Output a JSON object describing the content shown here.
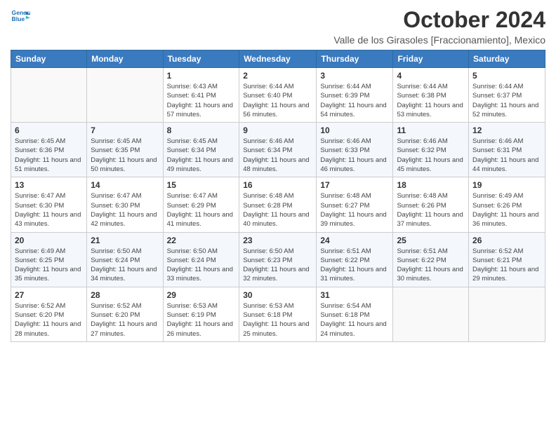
{
  "header": {
    "logo_line1": "General",
    "logo_line2": "Blue",
    "month_title": "October 2024",
    "subtitle": "Valle de los Girasoles [Fraccionamiento], Mexico"
  },
  "days_of_week": [
    "Sunday",
    "Monday",
    "Tuesday",
    "Wednesday",
    "Thursday",
    "Friday",
    "Saturday"
  ],
  "weeks": [
    [
      {
        "day": "",
        "info": ""
      },
      {
        "day": "",
        "info": ""
      },
      {
        "day": "1",
        "info": "Sunrise: 6:43 AM\nSunset: 6:41 PM\nDaylight: 11 hours and 57 minutes."
      },
      {
        "day": "2",
        "info": "Sunrise: 6:44 AM\nSunset: 6:40 PM\nDaylight: 11 hours and 56 minutes."
      },
      {
        "day": "3",
        "info": "Sunrise: 6:44 AM\nSunset: 6:39 PM\nDaylight: 11 hours and 54 minutes."
      },
      {
        "day": "4",
        "info": "Sunrise: 6:44 AM\nSunset: 6:38 PM\nDaylight: 11 hours and 53 minutes."
      },
      {
        "day": "5",
        "info": "Sunrise: 6:44 AM\nSunset: 6:37 PM\nDaylight: 11 hours and 52 minutes."
      }
    ],
    [
      {
        "day": "6",
        "info": "Sunrise: 6:45 AM\nSunset: 6:36 PM\nDaylight: 11 hours and 51 minutes."
      },
      {
        "day": "7",
        "info": "Sunrise: 6:45 AM\nSunset: 6:35 PM\nDaylight: 11 hours and 50 minutes."
      },
      {
        "day": "8",
        "info": "Sunrise: 6:45 AM\nSunset: 6:34 PM\nDaylight: 11 hours and 49 minutes."
      },
      {
        "day": "9",
        "info": "Sunrise: 6:46 AM\nSunset: 6:34 PM\nDaylight: 11 hours and 48 minutes."
      },
      {
        "day": "10",
        "info": "Sunrise: 6:46 AM\nSunset: 6:33 PM\nDaylight: 11 hours and 46 minutes."
      },
      {
        "day": "11",
        "info": "Sunrise: 6:46 AM\nSunset: 6:32 PM\nDaylight: 11 hours and 45 minutes."
      },
      {
        "day": "12",
        "info": "Sunrise: 6:46 AM\nSunset: 6:31 PM\nDaylight: 11 hours and 44 minutes."
      }
    ],
    [
      {
        "day": "13",
        "info": "Sunrise: 6:47 AM\nSunset: 6:30 PM\nDaylight: 11 hours and 43 minutes."
      },
      {
        "day": "14",
        "info": "Sunrise: 6:47 AM\nSunset: 6:30 PM\nDaylight: 11 hours and 42 minutes."
      },
      {
        "day": "15",
        "info": "Sunrise: 6:47 AM\nSunset: 6:29 PM\nDaylight: 11 hours and 41 minutes."
      },
      {
        "day": "16",
        "info": "Sunrise: 6:48 AM\nSunset: 6:28 PM\nDaylight: 11 hours and 40 minutes."
      },
      {
        "day": "17",
        "info": "Sunrise: 6:48 AM\nSunset: 6:27 PM\nDaylight: 11 hours and 39 minutes."
      },
      {
        "day": "18",
        "info": "Sunrise: 6:48 AM\nSunset: 6:26 PM\nDaylight: 11 hours and 37 minutes."
      },
      {
        "day": "19",
        "info": "Sunrise: 6:49 AM\nSunset: 6:26 PM\nDaylight: 11 hours and 36 minutes."
      }
    ],
    [
      {
        "day": "20",
        "info": "Sunrise: 6:49 AM\nSunset: 6:25 PM\nDaylight: 11 hours and 35 minutes."
      },
      {
        "day": "21",
        "info": "Sunrise: 6:50 AM\nSunset: 6:24 PM\nDaylight: 11 hours and 34 minutes."
      },
      {
        "day": "22",
        "info": "Sunrise: 6:50 AM\nSunset: 6:24 PM\nDaylight: 11 hours and 33 minutes."
      },
      {
        "day": "23",
        "info": "Sunrise: 6:50 AM\nSunset: 6:23 PM\nDaylight: 11 hours and 32 minutes."
      },
      {
        "day": "24",
        "info": "Sunrise: 6:51 AM\nSunset: 6:22 PM\nDaylight: 11 hours and 31 minutes."
      },
      {
        "day": "25",
        "info": "Sunrise: 6:51 AM\nSunset: 6:22 PM\nDaylight: 11 hours and 30 minutes."
      },
      {
        "day": "26",
        "info": "Sunrise: 6:52 AM\nSunset: 6:21 PM\nDaylight: 11 hours and 29 minutes."
      }
    ],
    [
      {
        "day": "27",
        "info": "Sunrise: 6:52 AM\nSunset: 6:20 PM\nDaylight: 11 hours and 28 minutes."
      },
      {
        "day": "28",
        "info": "Sunrise: 6:52 AM\nSunset: 6:20 PM\nDaylight: 11 hours and 27 minutes."
      },
      {
        "day": "29",
        "info": "Sunrise: 6:53 AM\nSunset: 6:19 PM\nDaylight: 11 hours and 26 minutes."
      },
      {
        "day": "30",
        "info": "Sunrise: 6:53 AM\nSunset: 6:18 PM\nDaylight: 11 hours and 25 minutes."
      },
      {
        "day": "31",
        "info": "Sunrise: 6:54 AM\nSunset: 6:18 PM\nDaylight: 11 hours and 24 minutes."
      },
      {
        "day": "",
        "info": ""
      },
      {
        "day": "",
        "info": ""
      }
    ]
  ]
}
